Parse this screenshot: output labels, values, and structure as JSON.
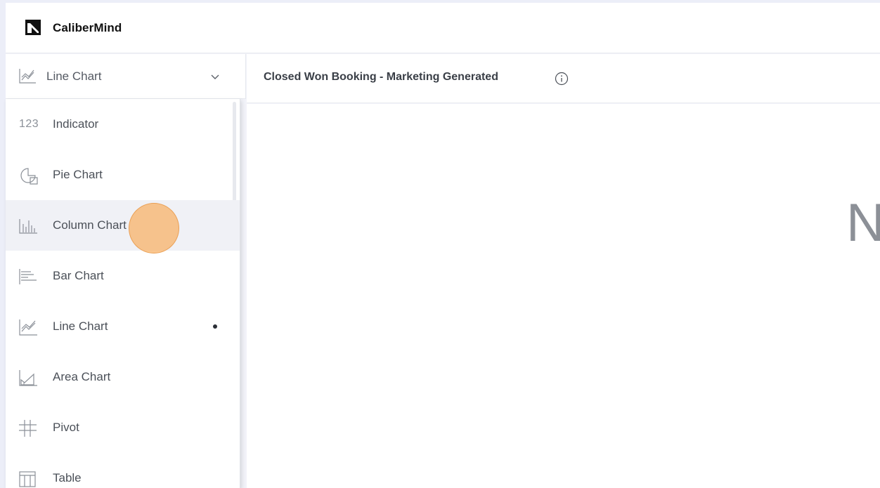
{
  "brand": {
    "name": "CaliberMind"
  },
  "selector": {
    "icon": "line-chart-icon",
    "label": "Line Chart"
  },
  "main": {
    "title": "Closed Won Booking - Marketing Generated",
    "partial_text": "N"
  },
  "menu": {
    "items": [
      {
        "label": "Indicator",
        "icon_text": "123",
        "icon": "indicator-icon",
        "selected": false
      },
      {
        "label": "Pie Chart",
        "icon": "pie-chart-icon",
        "selected": false
      },
      {
        "label": "Column Chart",
        "icon": "column-chart-icon",
        "selected": false
      },
      {
        "label": "Bar Chart",
        "icon": "bar-chart-icon",
        "selected": false
      },
      {
        "label": "Line Chart",
        "icon": "line-chart-icon",
        "selected": true
      },
      {
        "label": "Area Chart",
        "icon": "area-chart-icon",
        "selected": false
      },
      {
        "label": "Pivot",
        "icon": "pivot-icon",
        "selected": false
      },
      {
        "label": "Table",
        "icon": "table-icon",
        "selected": false
      }
    ]
  },
  "colors": {
    "text": "#4b5058",
    "hover": "#f0f1f6",
    "click_indicator": "#f8b062"
  }
}
